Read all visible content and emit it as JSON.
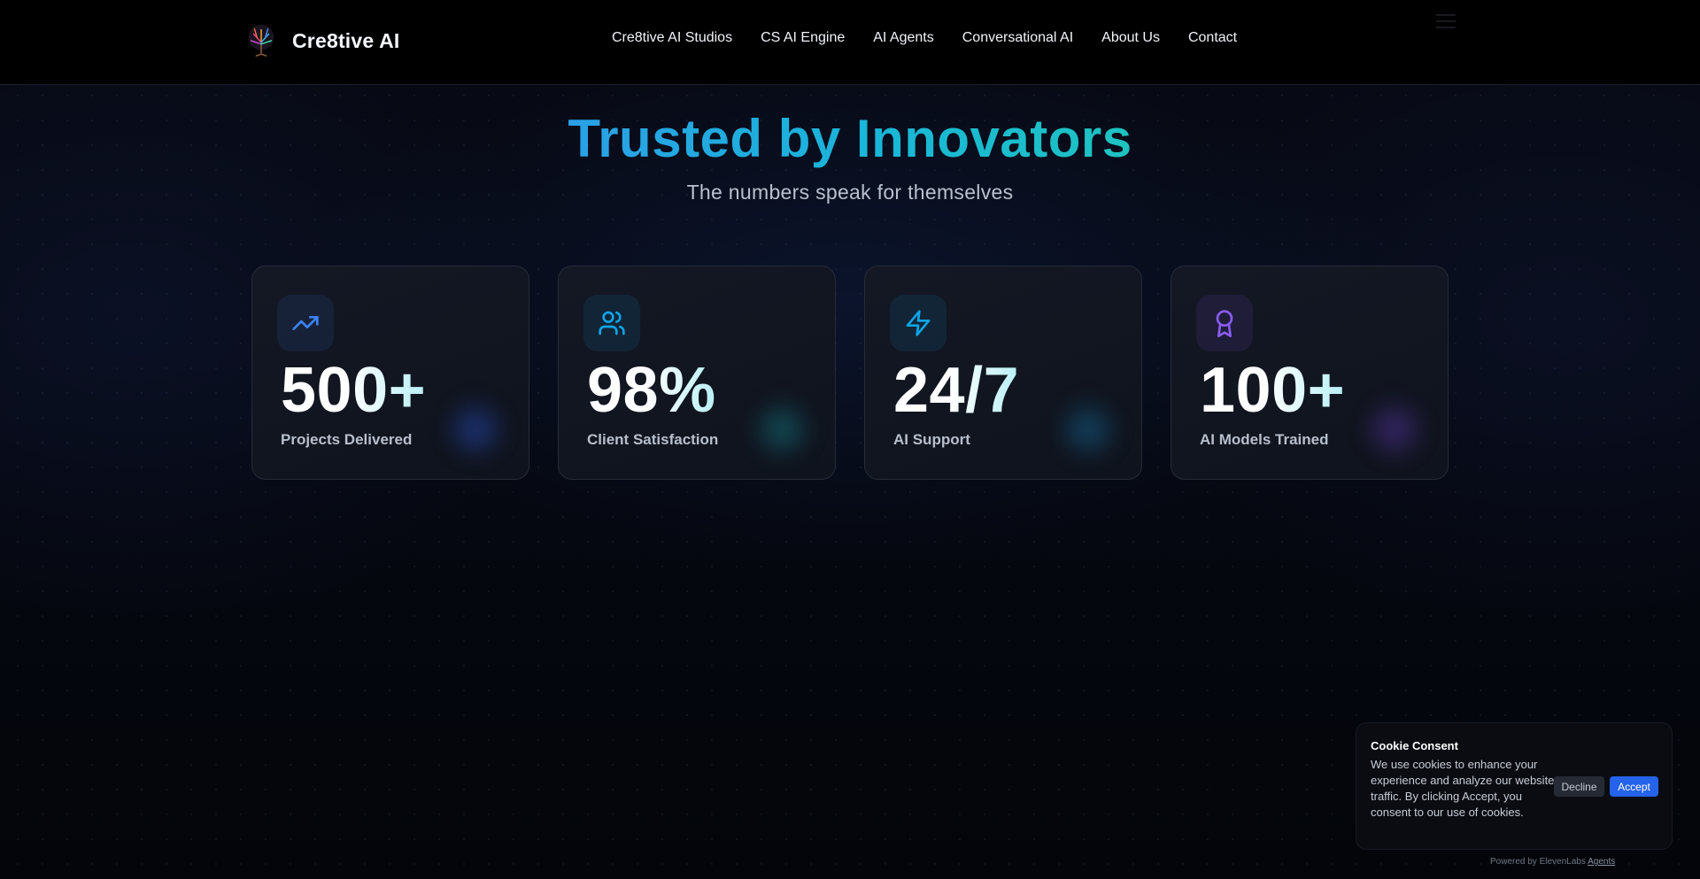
{
  "header": {
    "brand": "Cre8tive AI",
    "nav": [
      {
        "label": "Cre8tive AI Studios"
      },
      {
        "label": "CS AI Engine"
      },
      {
        "label": "AI Agents"
      },
      {
        "label": "Conversational AI"
      },
      {
        "label": "About Us"
      },
      {
        "label": "Contact"
      }
    ]
  },
  "hero": {
    "title": "Trusted by Innovators",
    "subtitle": "The numbers speak for themselves"
  },
  "stats": [
    {
      "value": "500+",
      "label": "Projects Delivered",
      "icon": "trending-up-icon",
      "color": "#3b82f6"
    },
    {
      "value": "98%",
      "label": "Client Satisfaction",
      "icon": "users-icon",
      "color": "#0ea5e9"
    },
    {
      "value": "24/7",
      "label": "AI Support",
      "icon": "zap-icon",
      "color": "#0ea5e9"
    },
    {
      "value": "100+",
      "label": "AI Models Trained",
      "icon": "award-icon",
      "color": "#8b5cf6"
    }
  ],
  "cookie": {
    "title": "Cookie Consent",
    "text": "We use cookies to enhance your experience and analyze our website traffic. By clicking Accept, you consent to our use of cookies.",
    "decline": "Decline",
    "accept": "Accept"
  },
  "footer": {
    "powered_by": "Powered by ElevenLabs",
    "powered_link": "Agents"
  }
}
